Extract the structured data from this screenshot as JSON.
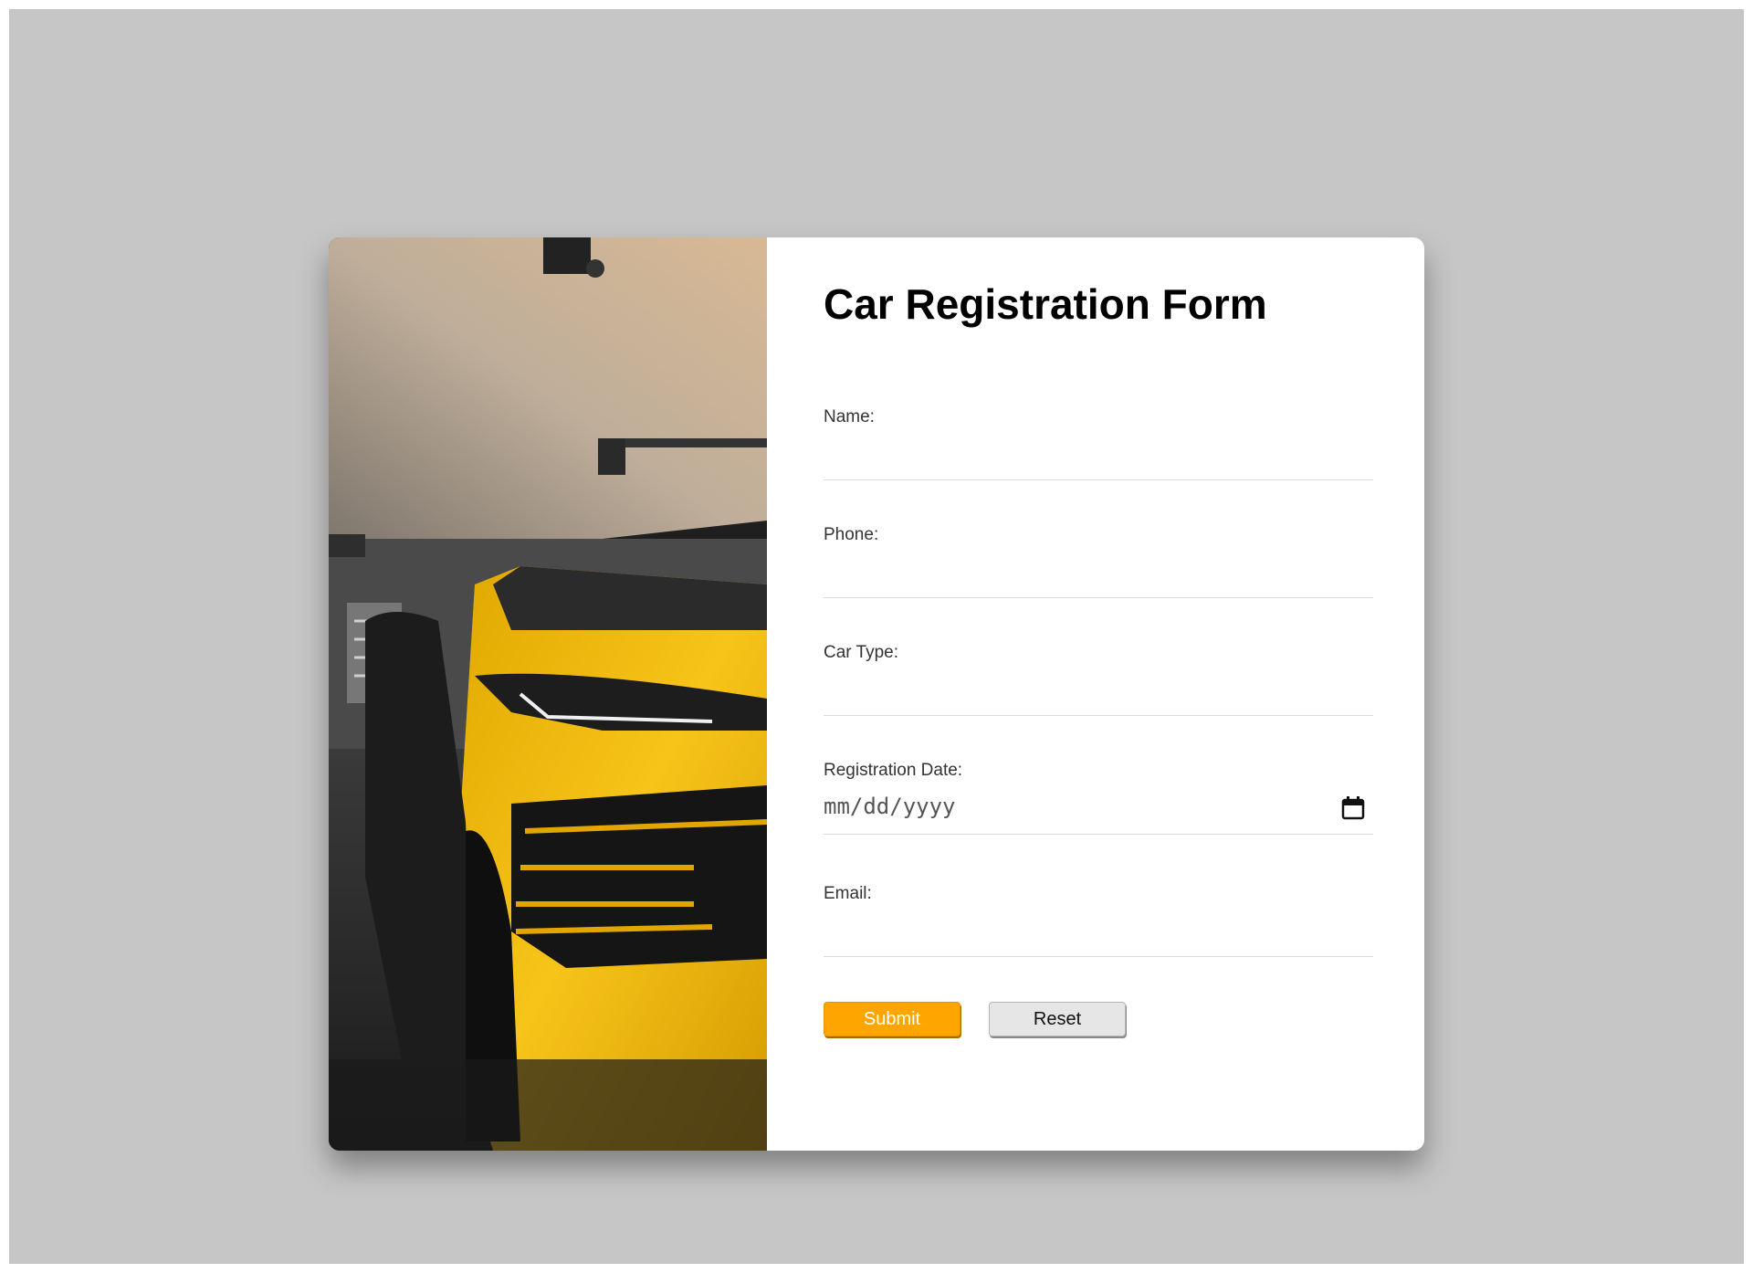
{
  "page": {
    "background_color": "#c6c6c6"
  },
  "form": {
    "title": "Car Registration Form",
    "fields": [
      {
        "label": "Name:",
        "value": "",
        "type": "text"
      },
      {
        "label": "Phone:",
        "value": "",
        "type": "tel"
      },
      {
        "label": "Car Type:",
        "value": "",
        "type": "text"
      },
      {
        "label": "Registration Date:",
        "placeholder": "mm/dd/yyyy",
        "type": "date",
        "icon": "calendar-icon"
      },
      {
        "label": "Email:",
        "value": "",
        "type": "email"
      }
    ],
    "submit_label": "Submit",
    "reset_label": "Reset"
  },
  "image": {
    "subject": "yellow SUV parked in a garage",
    "accent_color": "#f2b705"
  },
  "colors": {
    "submit": "#ffa500",
    "reset": "#e6e6e6"
  }
}
